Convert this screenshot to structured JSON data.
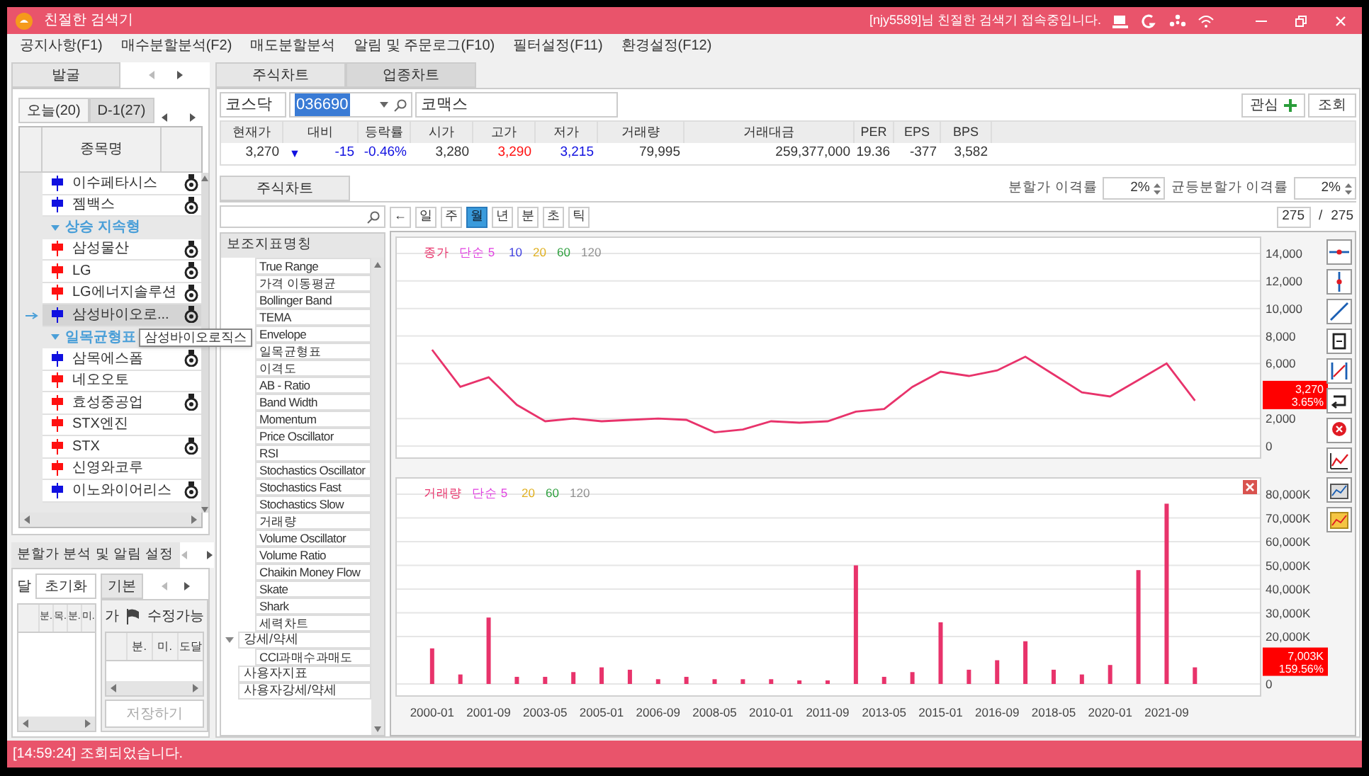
{
  "window": {
    "title": "친절한 검색기",
    "greeting": "[njy5589]님 친절한 검색기 접속중입니다."
  },
  "menu": [
    "공지사항(F1)",
    "매수분할분석(F2)",
    "매도분할분석",
    "알림 및 주문로그(F10)",
    "필터설정(F11)",
    "환경설정(F12)"
  ],
  "discovery": {
    "tab": "발굴",
    "subtabs": [
      {
        "label": "오늘(20)",
        "selected": true
      },
      {
        "label": "D-1(27)",
        "selected": false
      }
    ],
    "column": "종목명",
    "rows": [
      {
        "kind": "stock",
        "name": "이수페타시스",
        "color": "#1010e0",
        "medal": true,
        "selected": false
      },
      {
        "kind": "stock",
        "name": "젬백스",
        "color": "#1010e0",
        "medal": true,
        "selected": false
      },
      {
        "kind": "group",
        "name": "상승 지속형"
      },
      {
        "kind": "stock",
        "name": "삼성물산",
        "color": "#ff1010",
        "medal": true,
        "selected": false
      },
      {
        "kind": "stock",
        "name": "LG",
        "color": "#ff1010",
        "medal": true,
        "selected": false
      },
      {
        "kind": "stock",
        "name": "LG에너지솔루션",
        "color": "#ff1010",
        "medal": true,
        "selected": false
      },
      {
        "kind": "stock",
        "name": "삼성바이오로...",
        "color": "#1010e0",
        "medal": true,
        "selected": true
      },
      {
        "kind": "group",
        "name": "일목균형표"
      },
      {
        "kind": "stock",
        "name": "삼목에스폼",
        "color": "#1010e0",
        "medal": true,
        "selected": false
      },
      {
        "kind": "stock",
        "name": "네오오토",
        "color": "#ff1010",
        "medal": false,
        "selected": false
      },
      {
        "kind": "stock",
        "name": "효성중공업",
        "color": "#ff1010",
        "medal": true,
        "selected": false
      },
      {
        "kind": "stock",
        "name": "STX엔진",
        "color": "#ff1010",
        "medal": false,
        "selected": false
      },
      {
        "kind": "stock",
        "name": "STX",
        "color": "#ff1010",
        "medal": true,
        "selected": false
      },
      {
        "kind": "stock",
        "name": "신영와코루",
        "color": "#ff1010",
        "medal": false,
        "selected": false
      },
      {
        "kind": "stock",
        "name": "이노와이어리스",
        "color": "#1010e0",
        "medal": true,
        "selected": false
      }
    ],
    "tooltip": "삼성바이오로직스"
  },
  "split": {
    "tab": "분할가 분석 및 알림 설정",
    "left": {
      "label": "달",
      "reset": "초기화",
      "columns": [
        "분.",
        "목.",
        "분.",
        "미."
      ]
    },
    "right": {
      "tab": "기본",
      "label": "가",
      "flag_label": "수정가능",
      "columns": [
        "분.",
        "미.",
        "도달"
      ],
      "save": {
        "label": "저장하기",
        "disabled": true
      }
    }
  },
  "stock": {
    "tabs": [
      {
        "label": "주식차트",
        "selected": true
      },
      {
        "label": "업종차트",
        "selected": false
      }
    ],
    "market": "코스닥",
    "code": "036690",
    "name": "코맥스",
    "watch": "관심",
    "query": "조회",
    "quote": {
      "columns": [
        "현재가",
        "대비",
        "등락률",
        "시가",
        "고가",
        "저가",
        "거래량",
        "거래대금",
        "PER",
        "EPS",
        "BPS"
      ],
      "values": [
        {
          "text": "3,270",
          "color": "#333333"
        },
        {
          "text": "-15",
          "color": "#1010e0",
          "arrow": "▼"
        },
        {
          "text": "-0.46%",
          "color": "#1010e0"
        },
        {
          "text": "3,280",
          "color": "#333333"
        },
        {
          "text": "3,290",
          "color": "#ff1010"
        },
        {
          "text": "3,215",
          "color": "#1010e0"
        },
        {
          "text": "79,995",
          "color": "#333333"
        },
        {
          "text": "259,377,000",
          "color": "#333333"
        },
        {
          "text": "19.36",
          "color": "#333333"
        },
        {
          "text": "-377",
          "color": "#333333"
        },
        {
          "text": "3,582",
          "color": "#333333"
        }
      ]
    }
  },
  "chart_panel": {
    "tab": "주식차트",
    "split_gap": {
      "label": "분할가 이격률",
      "value": "2%"
    },
    "even_gap": {
      "label": "균등분할가 이격률",
      "value": "2%"
    },
    "back": "←",
    "periods": [
      {
        "label": "일",
        "selected": false
      },
      {
        "label": "주",
        "selected": false
      },
      {
        "label": "월",
        "selected": true
      },
      {
        "label": "년",
        "selected": false
      },
      {
        "label": "분",
        "selected": false
      },
      {
        "label": "초",
        "selected": false
      },
      {
        "label": "틱",
        "selected": false
      }
    ],
    "page": "275",
    "separator": "/",
    "total": "275"
  },
  "indicators": {
    "header": "보조지표명칭",
    "scrolled_items": [
      "True Range",
      "가격 이동평균",
      "Bollinger Band",
      "TEMA",
      "Envelope",
      "일목균형표",
      "이격도",
      "AB - Ratio",
      "Band Width",
      "Momentum",
      "Price Oscillator",
      "RSI",
      "Stochastics Oscillator",
      "Stochastics Fast",
      "Stochastics Slow",
      "거래량",
      "Volume Oscillator",
      "Volume Ratio",
      "Chaikin Money Flow",
      "Skate",
      "Shark",
      "세력차트"
    ],
    "groups": [
      {
        "label": "강세/약세",
        "expanded": true,
        "children": [
          {
            "label": "CCI과매수과매도"
          }
        ]
      },
      {
        "label": "사용자지표"
      },
      {
        "label": "사용자강세/약세"
      }
    ]
  },
  "price_chart": {
    "legend": [
      {
        "text": "단순 5",
        "color": "#e040e0"
      },
      {
        "text": "10",
        "color": "#4040e0"
      },
      {
        "text": "20",
        "color": "#e0b020"
      },
      {
        "text": "60",
        "color": "#30a040"
      },
      {
        "text": "120",
        "color": "#909090"
      }
    ],
    "badge": [
      "3,270",
      "3.65%"
    ],
    "chart_data": {
      "type": "line",
      "grid": true,
      "categories": [
        null,
        null,
        null,
        null,
        null,
        null,
        null,
        null,
        null,
        null,
        null,
        null,
        null,
        null,
        null,
        null,
        null,
        null,
        null,
        null,
        null,
        null,
        null,
        null,
        null,
        null,
        null,
        null
      ],
      "series": [
        {
          "name": "종가",
          "color": "#e8336b",
          "values": [
            7000,
            4300,
            5000,
            3000,
            1800,
            2000,
            1800,
            1900,
            2000,
            1900,
            1000,
            1200,
            1800,
            1700,
            1800,
            2500,
            2700,
            4300,
            5400,
            5100,
            5500,
            6500,
            5200,
            3900,
            3600,
            4800,
            6000,
            3300
          ]
        }
      ],
      "yticks": [
        {
          "value": 0,
          "label": "0"
        },
        {
          "value": 2000,
          "label": "2,000"
        },
        {
          "value": 6000,
          "label": "6,000"
        },
        {
          "value": 8000,
          "label": "8,000"
        },
        {
          "value": 10000,
          "label": "10,000"
        },
        {
          "value": 12000,
          "label": "12,000"
        },
        {
          "value": 14000,
          "label": "14,000"
        }
      ],
      "ylim": [
        0,
        14000
      ]
    }
  },
  "volume_chart": {
    "legend": [
      {
        "text": "단순 5",
        "color": "#e040e0"
      },
      {
        "text": "20",
        "color": "#e0b020"
      },
      {
        "text": "60",
        "color": "#30a040"
      },
      {
        "text": "120",
        "color": "#909090"
      }
    ],
    "badge": [
      "7,003K",
      "159.56%"
    ],
    "chart_data": {
      "type": "bar",
      "grid": true,
      "categories": [
        "2000-01",
        null,
        "2001-09",
        null,
        "2003-05",
        null,
        "2005-01",
        null,
        "2006-09",
        null,
        "2008-05",
        null,
        "2010-01",
        null,
        "2011-09",
        null,
        "2013-05",
        null,
        "2015-01",
        null,
        "2016-09",
        null,
        "2018-05",
        null,
        "2020-01",
        null,
        "2021-09",
        null
      ],
      "series": [
        {
          "name": "거래량",
          "color": "#e8336b",
          "values": [
            15000,
            4000,
            28000,
            3000,
            3000,
            5000,
            7000,
            6000,
            2000,
            3000,
            2000,
            2000,
            2000,
            1500,
            1500,
            50000,
            3000,
            5000,
            26000,
            6000,
            10000,
            18000,
            6000,
            4000,
            8000,
            48000,
            76000,
            7000
          ]
        }
      ],
      "yticks": [
        {
          "value": 0,
          "label": "0"
        },
        {
          "value": 20000,
          "label": "20,000K"
        },
        {
          "value": 30000,
          "label": "30,000K"
        },
        {
          "value": 40000,
          "label": "40,000K"
        },
        {
          "value": 50000,
          "label": "50,000K"
        },
        {
          "value": 60000,
          "label": "60,000K"
        },
        {
          "value": 70000,
          "label": "70,000K"
        },
        {
          "value": 80000,
          "label": "80,000K"
        }
      ],
      "ylim": [
        0,
        80000
      ]
    }
  },
  "status": "[14:59:24] 조회되었습니다."
}
